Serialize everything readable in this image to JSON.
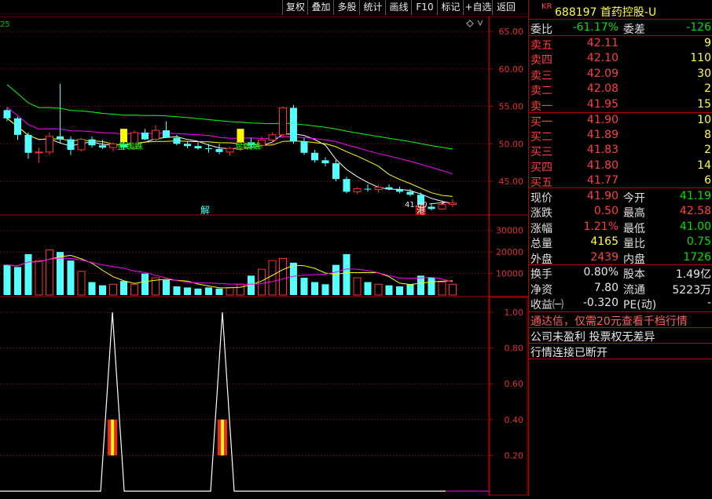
{
  "toolbar": {
    "buttons": [
      "复权",
      "叠加",
      "多股",
      "统计",
      "画线",
      "F10",
      "标记",
      "+自选",
      "返回"
    ]
  },
  "chart": {
    "corner_label": "25",
    "price_axis": [
      "65.00",
      "60.00",
      "55.00",
      "50.00",
      "45.00"
    ],
    "volume_axis": [
      "30000",
      "20000",
      "10000"
    ],
    "indicator_axis": [
      "1.00",
      "0.80",
      "0.60",
      "0.40",
      "0.20"
    ],
    "annotations": {
      "signal_1": "金蜘蛛",
      "signal_2": "金蜘蛛",
      "unlock_mark": "解",
      "hk_connect_mark": "港",
      "low_price_label": "41.00"
    },
    "colors": {
      "up": "#ff3232",
      "down": "#54ffff",
      "ma5": "#ffffff",
      "ma10": "#ffff00",
      "ma20": "#ff00ff",
      "ma60": "#00ff00",
      "grid": "#b00000"
    },
    "candles": [
      [
        54.5,
        54.8,
        53.0,
        53.4
      ],
      [
        53.4,
        53.6,
        50.5,
        51.2
      ],
      [
        51.2,
        51.5,
        48.0,
        48.8
      ],
      [
        48.8,
        49.5,
        47.5,
        48.9
      ],
      [
        48.9,
        51.5,
        48.5,
        51.0
      ],
      [
        51.0,
        58.0,
        50.0,
        50.6
      ],
      [
        50.6,
        51.0,
        48.5,
        49.2
      ],
      [
        49.2,
        50.8,
        49.0,
        50.6
      ],
      [
        50.6,
        51.0,
        49.5,
        49.8
      ],
      [
        49.8,
        50.5,
        49.3,
        49.5
      ],
      [
        49.5,
        50.2,
        49.0,
        50.0
      ],
      [
        50.0,
        50.5,
        49.2,
        49.5
      ],
      [
        49.5,
        51.8,
        49.2,
        51.5
      ],
      [
        51.5,
        52.0,
        50.5,
        50.6
      ],
      [
        50.6,
        52.5,
        50.3,
        51.8
      ],
      [
        51.8,
        53.0,
        51.0,
        50.8
      ],
      [
        50.8,
        51.2,
        49.8,
        50.0
      ],
      [
        50.0,
        50.4,
        49.4,
        49.7
      ],
      [
        49.7,
        50.2,
        49.2,
        49.4
      ],
      [
        49.4,
        50.0,
        48.8,
        49.3
      ],
      [
        49.3,
        50.0,
        48.6,
        48.9
      ],
      [
        48.9,
        49.6,
        48.4,
        49.4
      ],
      [
        49.4,
        50.4,
        49.0,
        50.2
      ],
      [
        50.2,
        50.8,
        49.6,
        49.8
      ],
      [
        49.8,
        51.0,
        49.4,
        50.5
      ],
      [
        50.5,
        51.5,
        50.0,
        51.2
      ],
      [
        51.2,
        55.0,
        50.8,
        54.8
      ],
      [
        54.8,
        55.2,
        50.0,
        50.3
      ],
      [
        50.3,
        50.8,
        48.5,
        48.8
      ],
      [
        48.8,
        49.2,
        47.5,
        47.8
      ],
      [
        47.8,
        48.2,
        47.0,
        47.4
      ],
      [
        47.4,
        47.8,
        45.0,
        45.3
      ],
      [
        45.3,
        45.6,
        43.4,
        43.6
      ],
      [
        43.6,
        44.2,
        43.3,
        44.0
      ],
      [
        44.0,
        44.6,
        43.6,
        43.9
      ],
      [
        43.9,
        44.5,
        43.5,
        44.2
      ],
      [
        44.2,
        44.6,
        43.8,
        43.9
      ],
      [
        43.9,
        44.3,
        43.4,
        43.6
      ],
      [
        43.6,
        44.0,
        43.0,
        43.2
      ],
      [
        43.2,
        43.5,
        41.0,
        41.6
      ],
      [
        41.6,
        42.0,
        41.1,
        41.3
      ],
      [
        41.3,
        42.0,
        41.2,
        41.9
      ],
      [
        41.9,
        42.6,
        41.5,
        42.1
      ]
    ],
    "volumes": [
      14000,
      13000,
      19000,
      16000,
      21000,
      20000,
      16000,
      11000,
      6000,
      4500,
      5000,
      6500,
      5000,
      10000,
      8000,
      7000,
      4000,
      3500,
      3000,
      3500,
      3000,
      3500,
      5000,
      9000,
      12000,
      16000,
      17000,
      15000,
      8000,
      6000,
      5000,
      14000,
      19000,
      8000,
      6000,
      5000,
      4500,
      4000,
      5000,
      9000,
      8000,
      6000,
      5000
    ],
    "peaks": [
      {
        "position": 0.23,
        "value": 1.0
      },
      {
        "position": 0.455,
        "value": 1.0
      }
    ]
  },
  "quote": {
    "title_tag": "KR",
    "title": "688197 首药控股-U",
    "weibi_label": "委比",
    "weibi_value": "-61.17%",
    "weicha_label": "委差",
    "weicha_value": "-126",
    "asks": [
      {
        "label": "卖五",
        "price": "42.11",
        "vol": "9"
      },
      {
        "label": "卖四",
        "price": "42.10",
        "vol": "110"
      },
      {
        "label": "卖三",
        "price": "42.09",
        "vol": "30"
      },
      {
        "label": "卖二",
        "price": "42.08",
        "vol": "2"
      },
      {
        "label": "卖一",
        "price": "41.95",
        "vol": "15"
      }
    ],
    "bids": [
      {
        "label": "买一",
        "price": "41.90",
        "vol": "10"
      },
      {
        "label": "买二",
        "price": "41.89",
        "vol": "8"
      },
      {
        "label": "买三",
        "price": "41.83",
        "vol": "2"
      },
      {
        "label": "买四",
        "price": "41.80",
        "vol": "14"
      },
      {
        "label": "买五",
        "price": "41.77",
        "vol": "6"
      }
    ],
    "stats": [
      {
        "l1": "现价",
        "v1": "41.90",
        "c1": "red",
        "l2": "今开",
        "v2": "41.19",
        "c2": "green"
      },
      {
        "l1": "涨跌",
        "v1": "0.50",
        "c1": "red",
        "l2": "最高",
        "v2": "42.58",
        "c2": "red"
      },
      {
        "l1": "涨幅",
        "v1": "1.21%",
        "c1": "red",
        "l2": "最低",
        "v2": "41.00",
        "c2": "green"
      },
      {
        "l1": "总量",
        "v1": "4165",
        "c1": "yellow",
        "l2": "量比",
        "v2": "0.75",
        "c2": "green"
      },
      {
        "l1": "外盘",
        "v1": "2439",
        "c1": "red",
        "l2": "内盘",
        "v2": "1726",
        "c2": "green"
      }
    ],
    "stats2": [
      {
        "l1": "换手",
        "v1": "0.80%",
        "c1": "white",
        "l2": "股本",
        "v2": "1.49亿",
        "c2": "white"
      },
      {
        "l1": "净资",
        "v1": "7.80",
        "c1": "white",
        "l2": "流通",
        "v2": "5223万",
        "c2": "white"
      },
      {
        "l1": "收益㈠",
        "v1": "-0.320",
        "c1": "white",
        "l2": "PE(动)",
        "v2": "-",
        "c2": "white"
      }
    ],
    "promo": "通达信，仅需20元查看千档行情",
    "note": "公司未盈利 投票权无差异",
    "status": "行情连接已断开"
  }
}
